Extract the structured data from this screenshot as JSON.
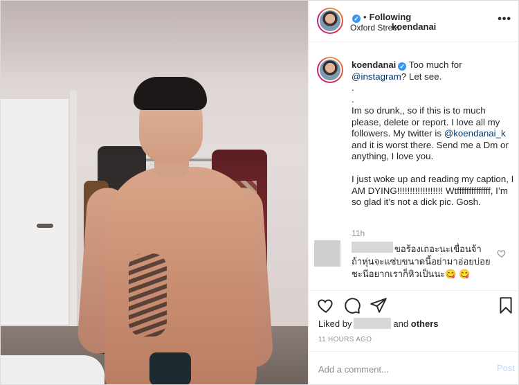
{
  "header": {
    "username": "koendanai",
    "verified_badge": "✓",
    "separator": "•",
    "follow_state": "Following",
    "location": "Oxford Street",
    "more_icon": "•••"
  },
  "caption": {
    "username": "koendanai",
    "text_part1": "Too much for ",
    "mention_instagram": "@instagram",
    "text_part2": "? Let see.",
    "dot1": ".",
    "dot2": ".",
    "text_part3": "Im so drunk,, so if this is to much please, delete or report. I love all my followers. My twitter is ",
    "mention_twitter": "@koendanai_k",
    "text_part4": " and it is worst there. Send me a Dm or anything, I love you.",
    "text_part5": "I just woke up and reading my caption, I AM DYING!!!!!!!!!!!!!!!!!! Wtffffffffffffff, I’m so glad it’s not a dick pic. Gosh.",
    "time_ago": "11h"
  },
  "comment": {
    "line1": "ขอร้องเถอะนะเขื่อนจ้า",
    "line2": "ถ้าหุ่นจะแซ่บขนาดนี้อย่ามาอ่อยบ่อย",
    "line3": "ชะนีอยากเราก็หิวเป็นนะ😋 😋"
  },
  "likes": {
    "prefix": "Liked by",
    "and": "and",
    "others": "others"
  },
  "date": "11 HOURS AGO",
  "add_comment": {
    "placeholder": "Add a comment...",
    "post_label": "Post"
  },
  "colors": {
    "verified": "#3897f0",
    "link": "#00376b",
    "muted": "#8e8e8e",
    "post_disabled": "#b3dbff"
  }
}
